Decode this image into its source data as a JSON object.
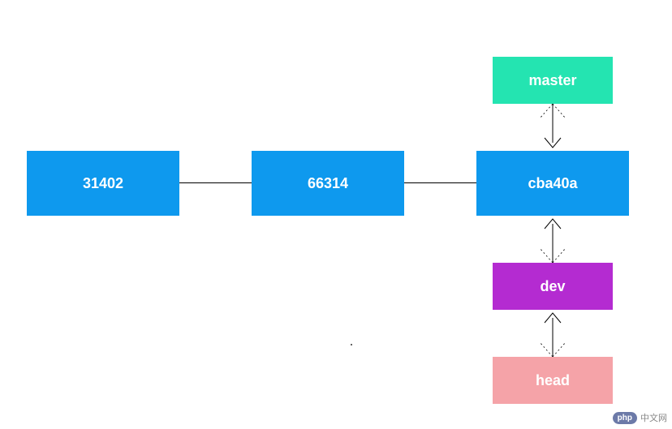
{
  "refs": {
    "master": {
      "label": "master",
      "color": "#24e4b1"
    },
    "dev": {
      "label": "dev",
      "color": "#b42bd1"
    },
    "head": {
      "label": "head",
      "color": "#f5a3a8"
    }
  },
  "commits": {
    "c1": {
      "label": "31402",
      "color": "#0e99ee"
    },
    "c2": {
      "label": "66314",
      "color": "#0e99ee"
    },
    "c3": {
      "label": "cba40a",
      "color": "#0e99ee"
    }
  },
  "watermark": {
    "badge": "php",
    "text": "中文网"
  }
}
